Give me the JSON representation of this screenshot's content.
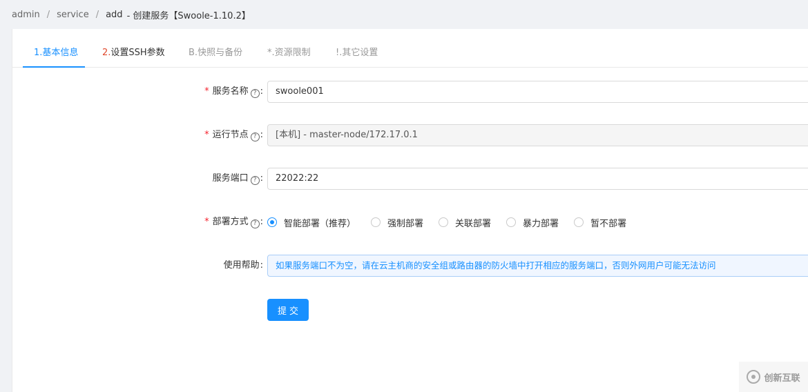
{
  "breadcrumb": {
    "items": [
      "admin",
      "service",
      "add"
    ],
    "separator": "/",
    "title": "- 创建服务【Swoole-1.10.2】"
  },
  "tabs": [
    {
      "num": "1.",
      "label": "基本信息",
      "state": "active"
    },
    {
      "num": "2.",
      "label": "设置SSH参数",
      "state": "done"
    },
    {
      "num": "B.",
      "label": "快照与备份",
      "state": "inactive"
    },
    {
      "num": "*.",
      "label": "资源限制",
      "state": "inactive"
    },
    {
      "num": "!.",
      "label": "其它设置",
      "state": "inactive"
    }
  ],
  "form": {
    "service_name": {
      "label": "服务名称",
      "value": "swoole001"
    },
    "run_node": {
      "label": "运行节点",
      "value": "[本机] - master-node/172.17.0.1"
    },
    "service_port": {
      "label": "服务端口",
      "value": "22022:22"
    },
    "deploy_mode": {
      "label": "部署方式",
      "options": [
        "智能部署（推荐）",
        "强制部署",
        "关联部署",
        "暴力部署",
        "暂不部署"
      ],
      "selected": "智能部署（推荐）"
    },
    "help": {
      "label": "使用帮助",
      "text": "如果服务端口不为空，请在云主机商的安全组或路由器的防火墙中打开相应的服务端口，否则外网用户可能无法访问"
    },
    "submit_label": "提交",
    "required_mark": "*",
    "help_icon_glyph": "?",
    "colon": ":"
  },
  "watermark": {
    "text": "创新互联"
  },
  "colors": {
    "primary": "#1890ff",
    "required": "#f5222d",
    "tab_number": "#e0482c"
  }
}
